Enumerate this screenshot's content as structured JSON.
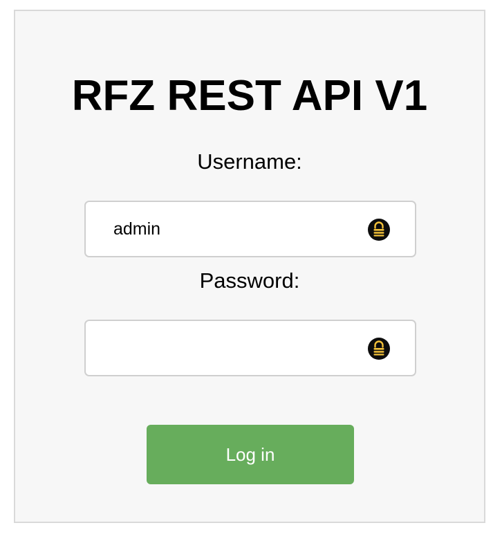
{
  "form": {
    "title": "RFZ REST API V1",
    "username": {
      "label": "Username:",
      "value": "admin",
      "icon": "password-manager-lock-icon"
    },
    "password": {
      "label": "Password:",
      "value": "",
      "icon": "password-manager-lock-icon"
    },
    "submit_label": "Log in"
  },
  "colors": {
    "panel_background": "#f7f7f7",
    "button_background": "#67ad5c",
    "button_text": "#ffffff",
    "icon_circle": "#0d0d0d",
    "icon_glyph": "#f3c13a"
  }
}
